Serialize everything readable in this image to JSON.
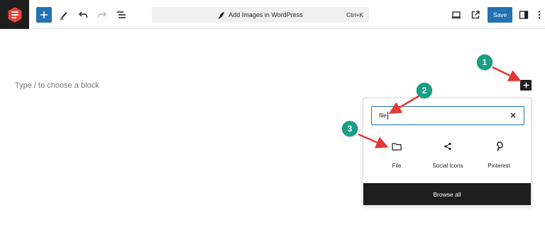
{
  "toolbar": {
    "logo_icon": "site-logo-icon",
    "inserter_icon": "plus-icon",
    "tools_icon": "pencil-icon",
    "undo_icon": "undo-icon",
    "redo_icon": "redo-icon",
    "list_view_icon": "list-view-icon",
    "command_bar": {
      "icon": "feather-icon",
      "title": "Add Images in WordPress",
      "shortcut": "Ctrl+K"
    },
    "preview_icon": "desktop-icon",
    "view_post_icon": "external-link-icon",
    "save_label": "Save",
    "settings_icon": "sidebar-toggle-icon",
    "options_icon": "more-vertical-icon"
  },
  "canvas": {
    "placeholder": "Type / to choose a block",
    "inline_inserter_icon": "plus-icon"
  },
  "inserter_popover": {
    "search": {
      "value": "file",
      "clear_icon": "close-icon"
    },
    "results": [
      {
        "label": "File",
        "icon": "folder-icon"
      },
      {
        "label": "Social Icons",
        "icon": "share-icon"
      },
      {
        "label": "Pinterest",
        "icon": "pinterest-icon"
      }
    ],
    "browse_all_label": "Browse all"
  },
  "annotations": [
    {
      "number": "1"
    },
    {
      "number": "2"
    },
    {
      "number": "3"
    }
  ],
  "colors": {
    "accent": "#2271b1",
    "dark": "#1e1e1e",
    "badge": "#16a085",
    "arrow": "#e53935"
  }
}
